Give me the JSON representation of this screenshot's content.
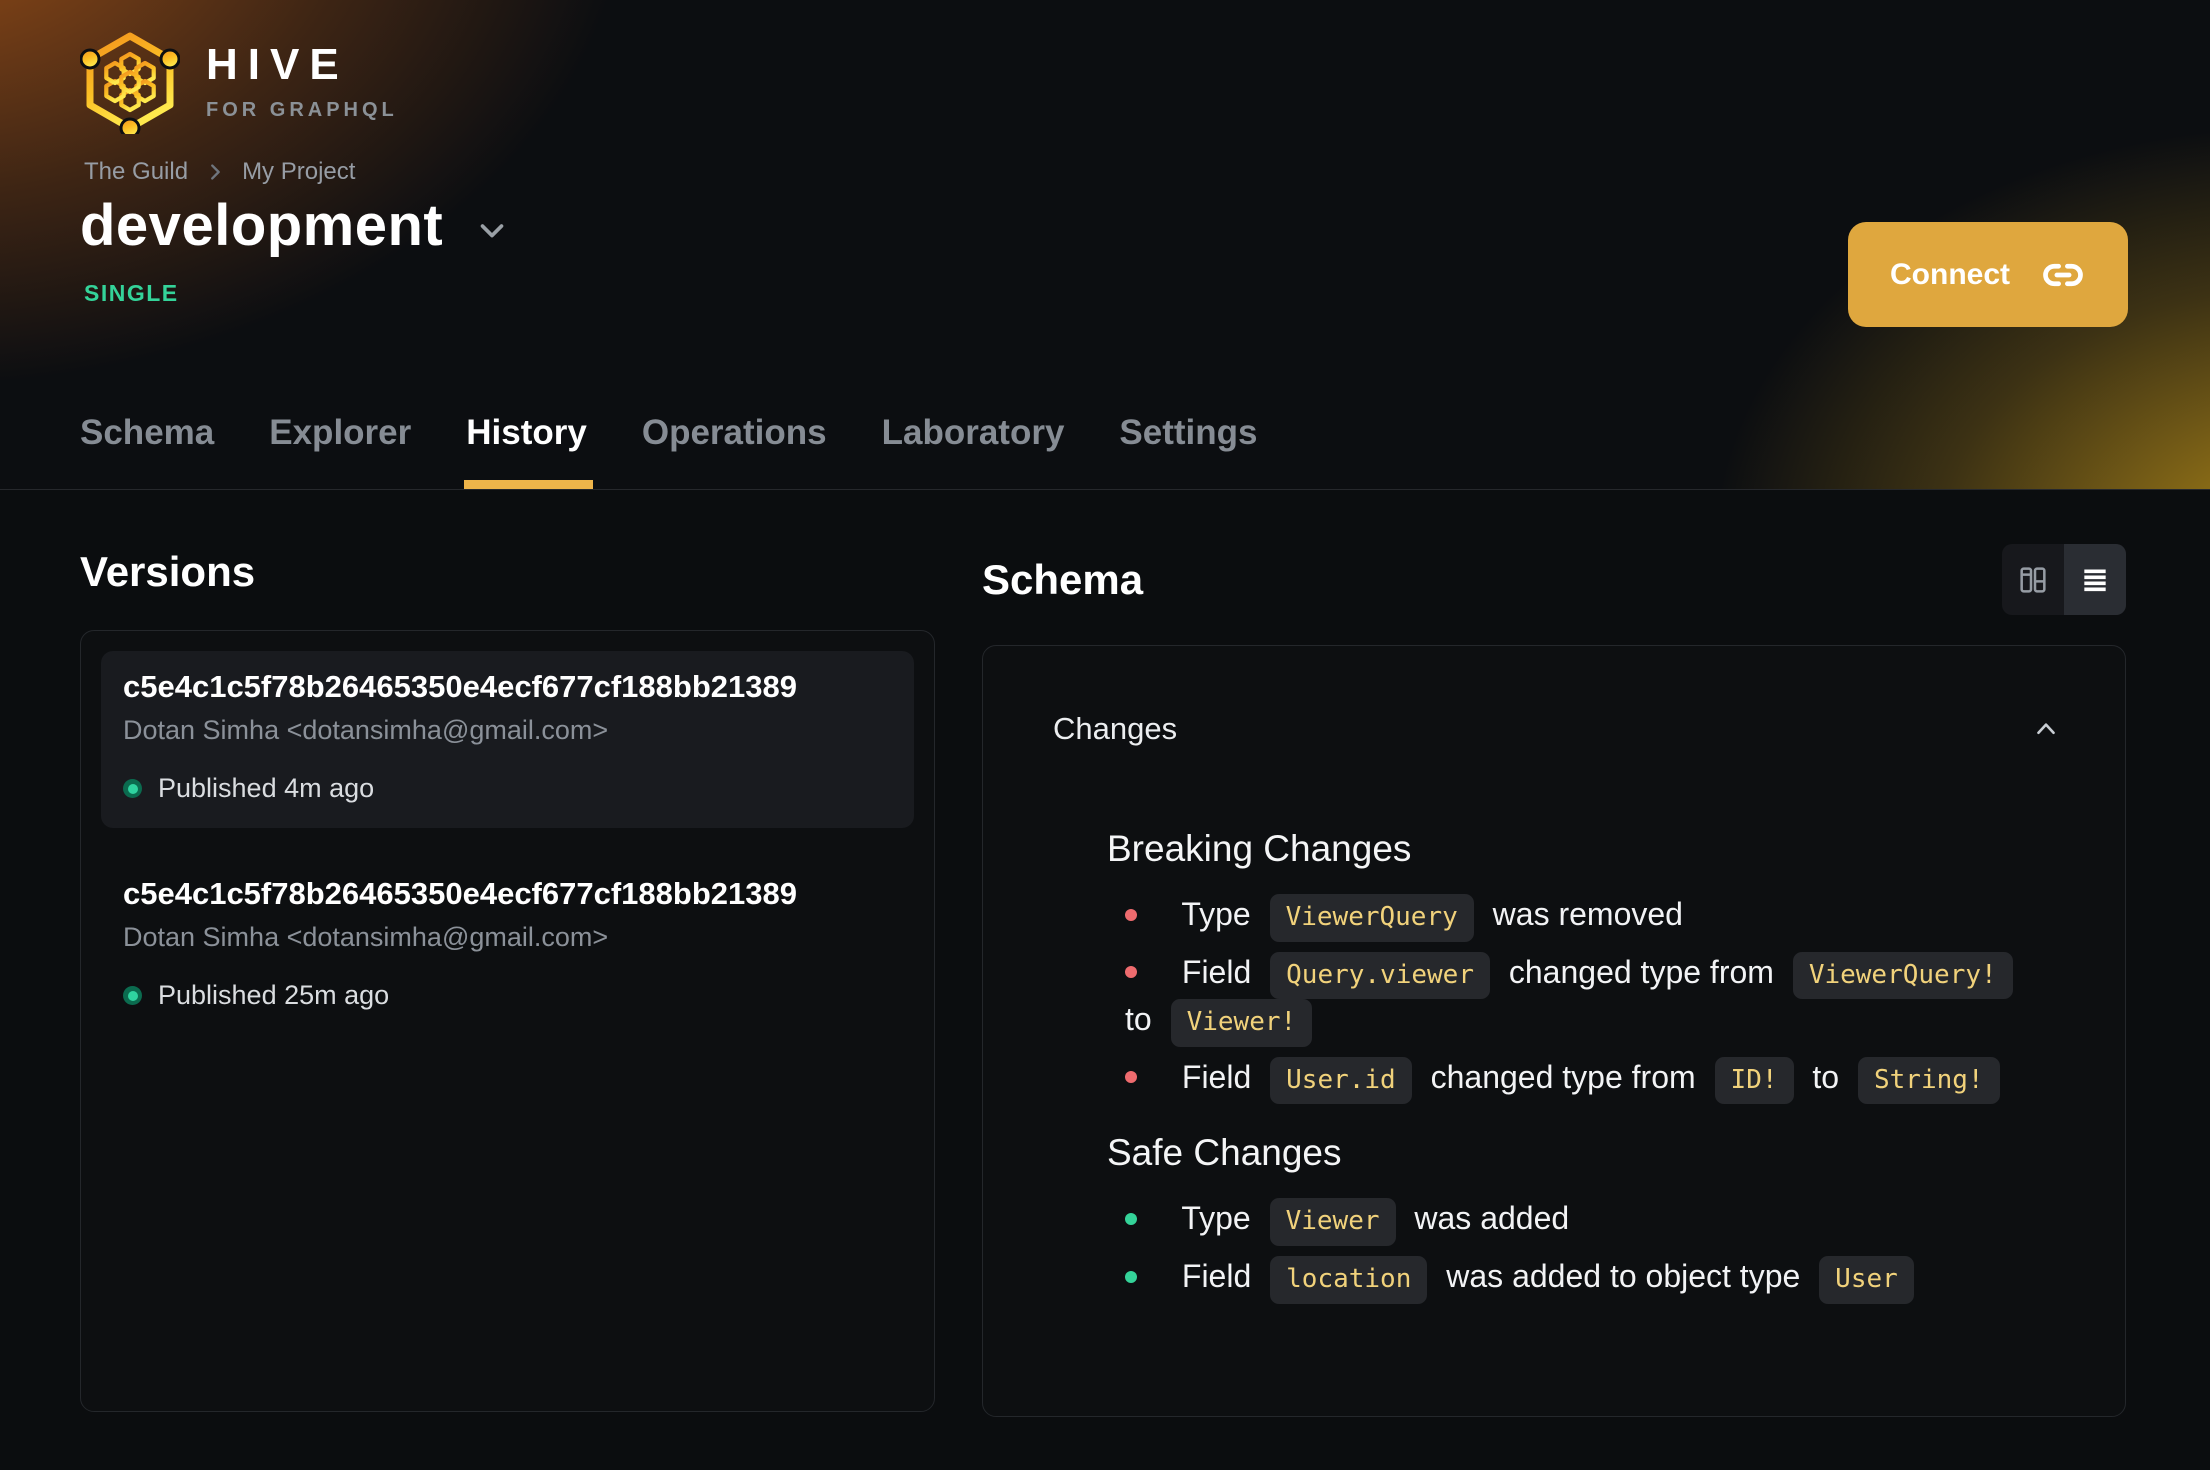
{
  "brand": {
    "name": "HIVE",
    "tagline": "FOR GRAPHQL",
    "logo_icon": "hive-honeycomb-hexagon-icon"
  },
  "breadcrumb": {
    "items": [
      "The Guild",
      "My Project"
    ],
    "separator_icon": "chevron-right-icon"
  },
  "project": {
    "name": "development",
    "type_badge": "SINGLE",
    "selector_icon": "chevron-down-icon"
  },
  "header_actions": {
    "connect": {
      "label": "Connect",
      "icon": "link-icon"
    }
  },
  "tabs": [
    {
      "label": "Schema",
      "active": false
    },
    {
      "label": "Explorer",
      "active": false
    },
    {
      "label": "History",
      "active": true
    },
    {
      "label": "Operations",
      "active": false
    },
    {
      "label": "Laboratory",
      "active": false
    },
    {
      "label": "Settings",
      "active": false
    }
  ],
  "versions": {
    "heading": "Versions",
    "items": [
      {
        "hash": "c5e4c1c5f78b26465350e4ecf677cf188bb21389",
        "author": "Dotan Simha <dotansimha@gmail.com>",
        "status": "Published 4m ago",
        "status_icon": "published-dot-icon",
        "selected": true
      },
      {
        "hash": "c5e4c1c5f78b26465350e4ecf677cf188bb21389",
        "author": "Dotan Simha <dotansimha@gmail.com>",
        "status": "Published 25m ago",
        "status_icon": "published-dot-icon",
        "selected": false
      }
    ]
  },
  "schema": {
    "heading": "Schema",
    "view_toggle": {
      "options": [
        {
          "name": "diff-view",
          "icon": "columns-icon",
          "active": false
        },
        {
          "name": "list-view",
          "icon": "list-icon",
          "active": true
        }
      ]
    },
    "changes": {
      "title": "Changes",
      "collapse_icon": "chevron-up-icon",
      "sections": [
        {
          "title": "Breaking Changes",
          "kind": "breaking",
          "items": [
            [
              {
                "t": "text",
                "v": "Type"
              },
              {
                "t": "code",
                "v": "ViewerQuery"
              },
              {
                "t": "text",
                "v": "was removed"
              }
            ],
            [
              {
                "t": "text",
                "v": "Field"
              },
              {
                "t": "code",
                "v": "Query.viewer"
              },
              {
                "t": "text",
                "v": "changed type from"
              },
              {
                "t": "code",
                "v": "ViewerQuery!"
              },
              {
                "t": "text",
                "v": "to"
              },
              {
                "t": "code",
                "v": "Viewer!"
              }
            ],
            [
              {
                "t": "text",
                "v": "Field"
              },
              {
                "t": "code",
                "v": "User.id"
              },
              {
                "t": "text",
                "v": "changed type from"
              },
              {
                "t": "code",
                "v": "ID!"
              },
              {
                "t": "text",
                "v": "to"
              },
              {
                "t": "code",
                "v": "String!"
              }
            ]
          ]
        },
        {
          "title": "Safe Changes",
          "kind": "safe",
          "items": [
            [
              {
                "t": "text",
                "v": "Type"
              },
              {
                "t": "code",
                "v": "Viewer"
              },
              {
                "t": "text",
                "v": "was added"
              }
            ],
            [
              {
                "t": "text",
                "v": "Field"
              },
              {
                "t": "code",
                "v": "location"
              },
              {
                "t": "text",
                "v": "was added to object type"
              },
              {
                "t": "code",
                "v": "User"
              }
            ]
          ]
        }
      ]
    }
  },
  "colors": {
    "accent": "#edb44a",
    "connect_bg": "#dfa73e",
    "badge_green": "#34d399",
    "breaking_bullet": "#ee6b6e",
    "safe_bullet": "#34d399",
    "chip_text": "#f1d27b",
    "chip_bg": "#26282c",
    "page_bg": "#0b0d0f",
    "panel_border": "#24272b",
    "selected_card_bg": "#191b1f",
    "muted_text": "#8b9199"
  }
}
